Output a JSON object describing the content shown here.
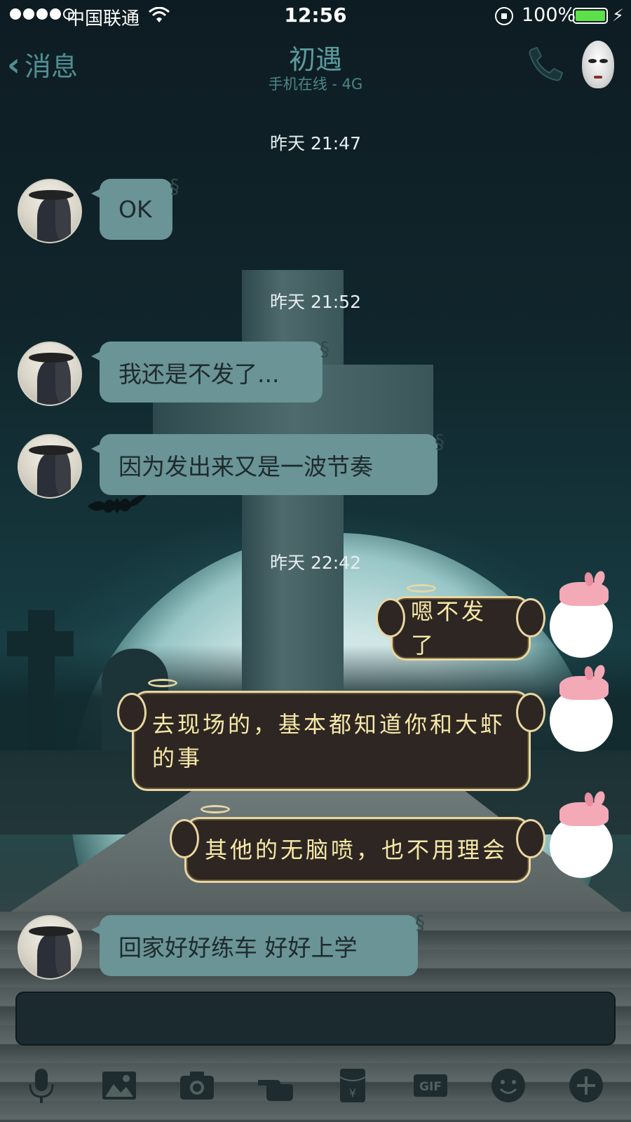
{
  "status": {
    "carrier": "中国联通",
    "time": "12:56",
    "battery": "100%"
  },
  "nav": {
    "back_label": "消息",
    "title": "初遇",
    "subtitle": "手机在线 - 4G"
  },
  "messages": [
    {
      "type": "timestamp",
      "text": "昨天 21:47"
    },
    {
      "type": "incoming",
      "text": "OK"
    },
    {
      "type": "timestamp",
      "text": "昨天 21:52"
    },
    {
      "type": "incoming",
      "text": "我还是不发了..."
    },
    {
      "type": "incoming",
      "text": "因为发出来又是一波节奏"
    },
    {
      "type": "timestamp",
      "text": "昨天 22:42"
    },
    {
      "type": "outgoing",
      "text": "嗯不发了"
    },
    {
      "type": "outgoing",
      "text": "去现场的，基本都知道你和大虾的事"
    },
    {
      "type": "outgoing",
      "text": "其他的无脑喷，也不用理会"
    },
    {
      "type": "incoming",
      "text": "回家好好练车 好好上学"
    }
  ],
  "toolbar": {
    "icons": [
      "microphone-icon",
      "image-icon",
      "camera-icon",
      "hand-point-icon",
      "red-packet-icon",
      "gif-icon",
      "emoji-icon",
      "plus-icon"
    ],
    "gif_label": "GIF",
    "red_packet_symbol": "¥"
  },
  "colors": {
    "incoming_bubble": "#6a9496",
    "outgoing_bubble": "#2e2622",
    "outgoing_text": "#f7e9a8",
    "nav_accent": "#5c9ca0",
    "battery": "#5ee04a"
  }
}
